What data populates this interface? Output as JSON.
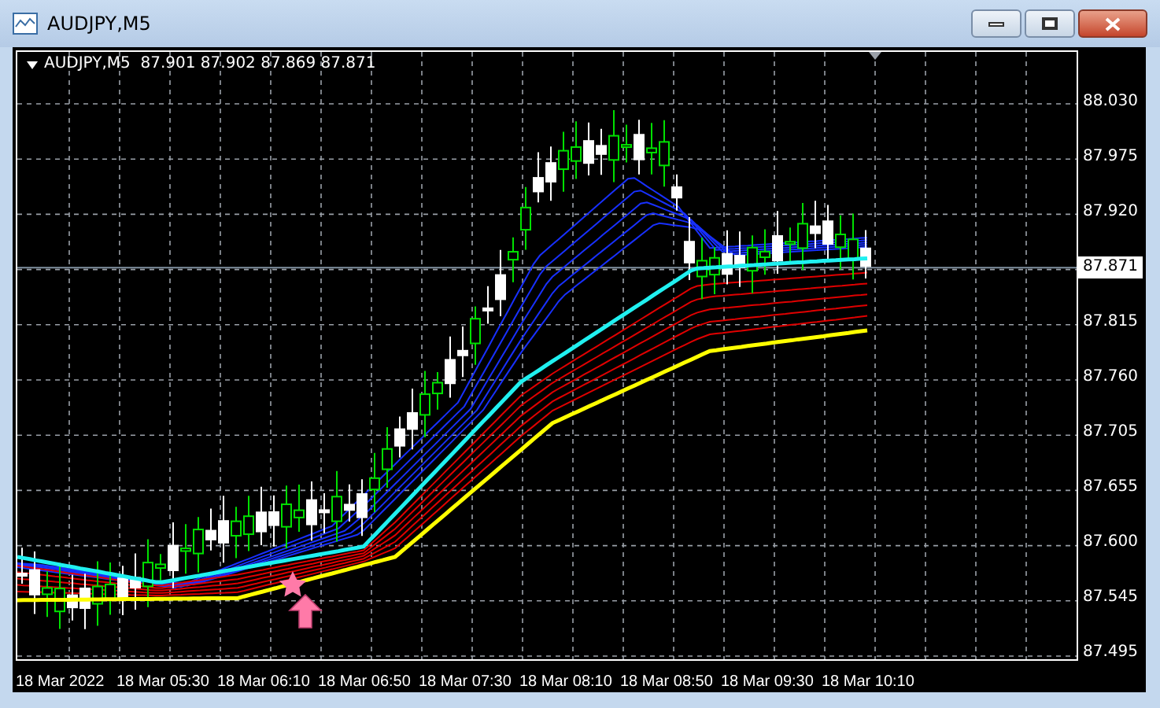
{
  "window": {
    "title": "AUDJPY,M5"
  },
  "chart": {
    "legend": "AUDJPY,M5  87.901 87.902 87.869 87.871",
    "y_axis": [
      {
        "text": "88.030",
        "kind": "tick"
      },
      {
        "text": "87.975",
        "kind": "tick"
      },
      {
        "text": "87.920",
        "kind": "tick"
      },
      {
        "text": "87.871",
        "kind": "current"
      },
      {
        "text": "87.815",
        "kind": "tick"
      },
      {
        "text": "87.760",
        "kind": "tick"
      },
      {
        "text": "87.705",
        "kind": "tick"
      },
      {
        "text": "87.655",
        "kind": "tick"
      },
      {
        "text": "87.600",
        "kind": "tick"
      },
      {
        "text": "87.545",
        "kind": "tick"
      },
      {
        "text": "87.495",
        "kind": "tick"
      }
    ],
    "x_axis": [
      "18 Mar 2022",
      "18 Mar 05:30",
      "18 Mar 06:10",
      "18 Mar 06:50",
      "18 Mar 07:30",
      "18 Mar 08:10",
      "18 Mar 08:50",
      "18 Mar 09:30",
      "18 Mar 10:10"
    ]
  }
}
